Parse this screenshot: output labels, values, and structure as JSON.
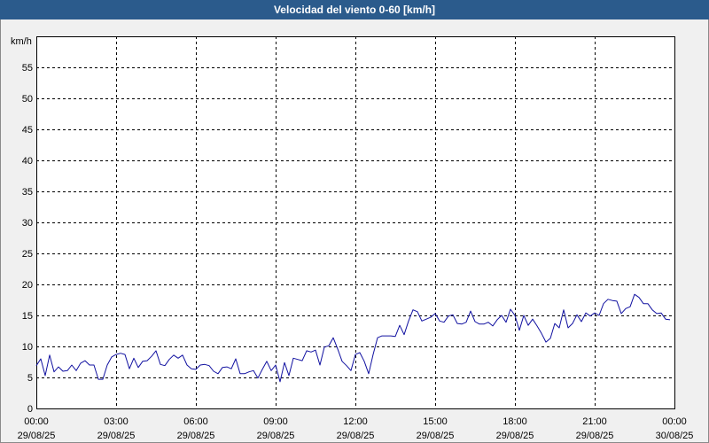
{
  "colors": {
    "title_bar": "#2B5B8C",
    "title_text": "#FFFFFF",
    "background": "#F0F0F0",
    "plot_background": "#FFFFFF",
    "grid": "#000000",
    "line": "#1010A0",
    "page_border": "#8A8A8A"
  },
  "chart_data": {
    "type": "line",
    "title": "Velocidad del viento 0-60 [km/h]",
    "xlabel": "",
    "ylabel": "km/h",
    "ylim": [
      0,
      60
    ],
    "y_ticks": [
      0,
      5,
      10,
      15,
      20,
      25,
      30,
      35,
      40,
      45,
      50,
      55
    ],
    "x_ticks": [
      {
        "time": "00:00",
        "date": "29/08/25"
      },
      {
        "time": "03:00",
        "date": "29/08/25"
      },
      {
        "time": "06:00",
        "date": "29/08/25"
      },
      {
        "time": "09:00",
        "date": "29/08/25"
      },
      {
        "time": "12:00",
        "date": "29/08/25"
      },
      {
        "time": "15:00",
        "date": "29/08/25"
      },
      {
        "time": "18:00",
        "date": "29/08/25"
      },
      {
        "time": "21:00",
        "date": "29/08/25"
      },
      {
        "time": "00:00",
        "date": "30/08/25"
      }
    ],
    "grid": true,
    "x": [
      "00:00",
      "00:10",
      "00:20",
      "00:30",
      "00:40",
      "00:50",
      "01:00",
      "01:10",
      "01:20",
      "01:30",
      "01:40",
      "01:50",
      "02:00",
      "02:10",
      "02:20",
      "02:30",
      "02:40",
      "02:50",
      "03:00",
      "03:10",
      "03:20",
      "03:30",
      "03:40",
      "03:50",
      "04:00",
      "04:10",
      "04:20",
      "04:30",
      "04:40",
      "04:50",
      "05:00",
      "05:10",
      "05:20",
      "05:30",
      "05:40",
      "05:50",
      "06:00",
      "06:10",
      "06:20",
      "06:30",
      "06:40",
      "06:50",
      "07:00",
      "07:10",
      "07:20",
      "07:30",
      "07:40",
      "07:50",
      "08:00",
      "08:10",
      "08:20",
      "08:30",
      "08:40",
      "08:50",
      "09:00",
      "09:10",
      "09:20",
      "09:30",
      "09:40",
      "09:50",
      "10:00",
      "10:10",
      "10:20",
      "10:30",
      "10:40",
      "10:50",
      "11:00",
      "11:10",
      "11:20",
      "11:30",
      "11:40",
      "11:50",
      "12:00",
      "12:10",
      "12:20",
      "12:30",
      "12:40",
      "12:50",
      "13:00",
      "13:10",
      "13:20",
      "13:30",
      "13:40",
      "13:50",
      "14:00",
      "14:10",
      "14:20",
      "14:30",
      "14:40",
      "14:50",
      "15:00",
      "15:10",
      "15:20",
      "15:30",
      "15:40",
      "15:50",
      "16:00",
      "16:10",
      "16:20",
      "16:30",
      "16:40",
      "16:50",
      "17:00",
      "17:10",
      "17:20",
      "17:30",
      "17:40",
      "17:50",
      "18:00",
      "18:10",
      "18:20",
      "18:30",
      "18:40",
      "18:50",
      "19:00",
      "19:10",
      "19:20",
      "19:30",
      "19:40",
      "19:50",
      "20:00",
      "20:10",
      "20:20",
      "20:30",
      "20:40",
      "20:50",
      "21:00",
      "21:10",
      "21:20",
      "21:30",
      "21:40",
      "21:50",
      "22:00",
      "22:10",
      "22:20",
      "22:30",
      "22:40",
      "22:50",
      "23:00",
      "23:10",
      "23:20",
      "23:30",
      "23:40",
      "23:50"
    ],
    "series": [
      {
        "values": [
          6.9,
          8.0,
          5.3,
          8.6,
          5.9,
          6.7,
          6.0,
          6.1,
          7.0,
          6.1,
          7.3,
          7.7,
          7.0,
          7.0,
          4.7,
          4.7,
          7.0,
          8.3,
          8.7,
          8.9,
          8.7,
          6.4,
          8.1,
          6.6,
          7.6,
          7.7,
          8.4,
          9.3,
          7.1,
          6.9,
          7.9,
          8.6,
          8.1,
          8.6,
          7.0,
          6.4,
          6.3,
          7.0,
          7.1,
          6.9,
          6.0,
          5.6,
          6.6,
          6.7,
          6.4,
          8.0,
          5.6,
          5.6,
          5.9,
          6.1,
          4.9,
          6.3,
          7.6,
          6.1,
          7.0,
          4.3,
          7.4,
          5.3,
          8.1,
          7.9,
          7.7,
          9.3,
          9.1,
          9.4,
          7.0,
          9.9,
          10.1,
          11.4,
          9.6,
          7.6,
          6.9,
          6.1,
          8.7,
          9.0,
          7.6,
          5.6,
          8.7,
          11.4,
          11.7,
          11.7,
          11.7,
          11.6,
          13.4,
          11.9,
          14.1,
          15.9,
          15.6,
          14.1,
          14.4,
          14.7,
          15.3,
          14.1,
          13.9,
          14.9,
          15.1,
          13.7,
          13.6,
          13.9,
          15.7,
          14.0,
          13.6,
          13.6,
          13.9,
          13.3,
          14.3,
          15.0,
          13.9,
          16.0,
          15.0,
          12.6,
          15.0,
          13.4,
          14.4,
          13.3,
          12.1,
          10.7,
          11.3,
          13.7,
          13.0,
          15.9,
          13.0,
          13.7,
          15.1,
          14.0,
          15.4,
          14.9,
          15.4,
          15.0,
          16.9,
          17.6,
          17.4,
          17.3,
          15.3,
          16.1,
          16.4,
          18.4,
          17.9,
          16.9,
          16.9,
          15.9,
          15.3,
          15.4,
          14.4,
          14.3
        ]
      }
    ]
  }
}
